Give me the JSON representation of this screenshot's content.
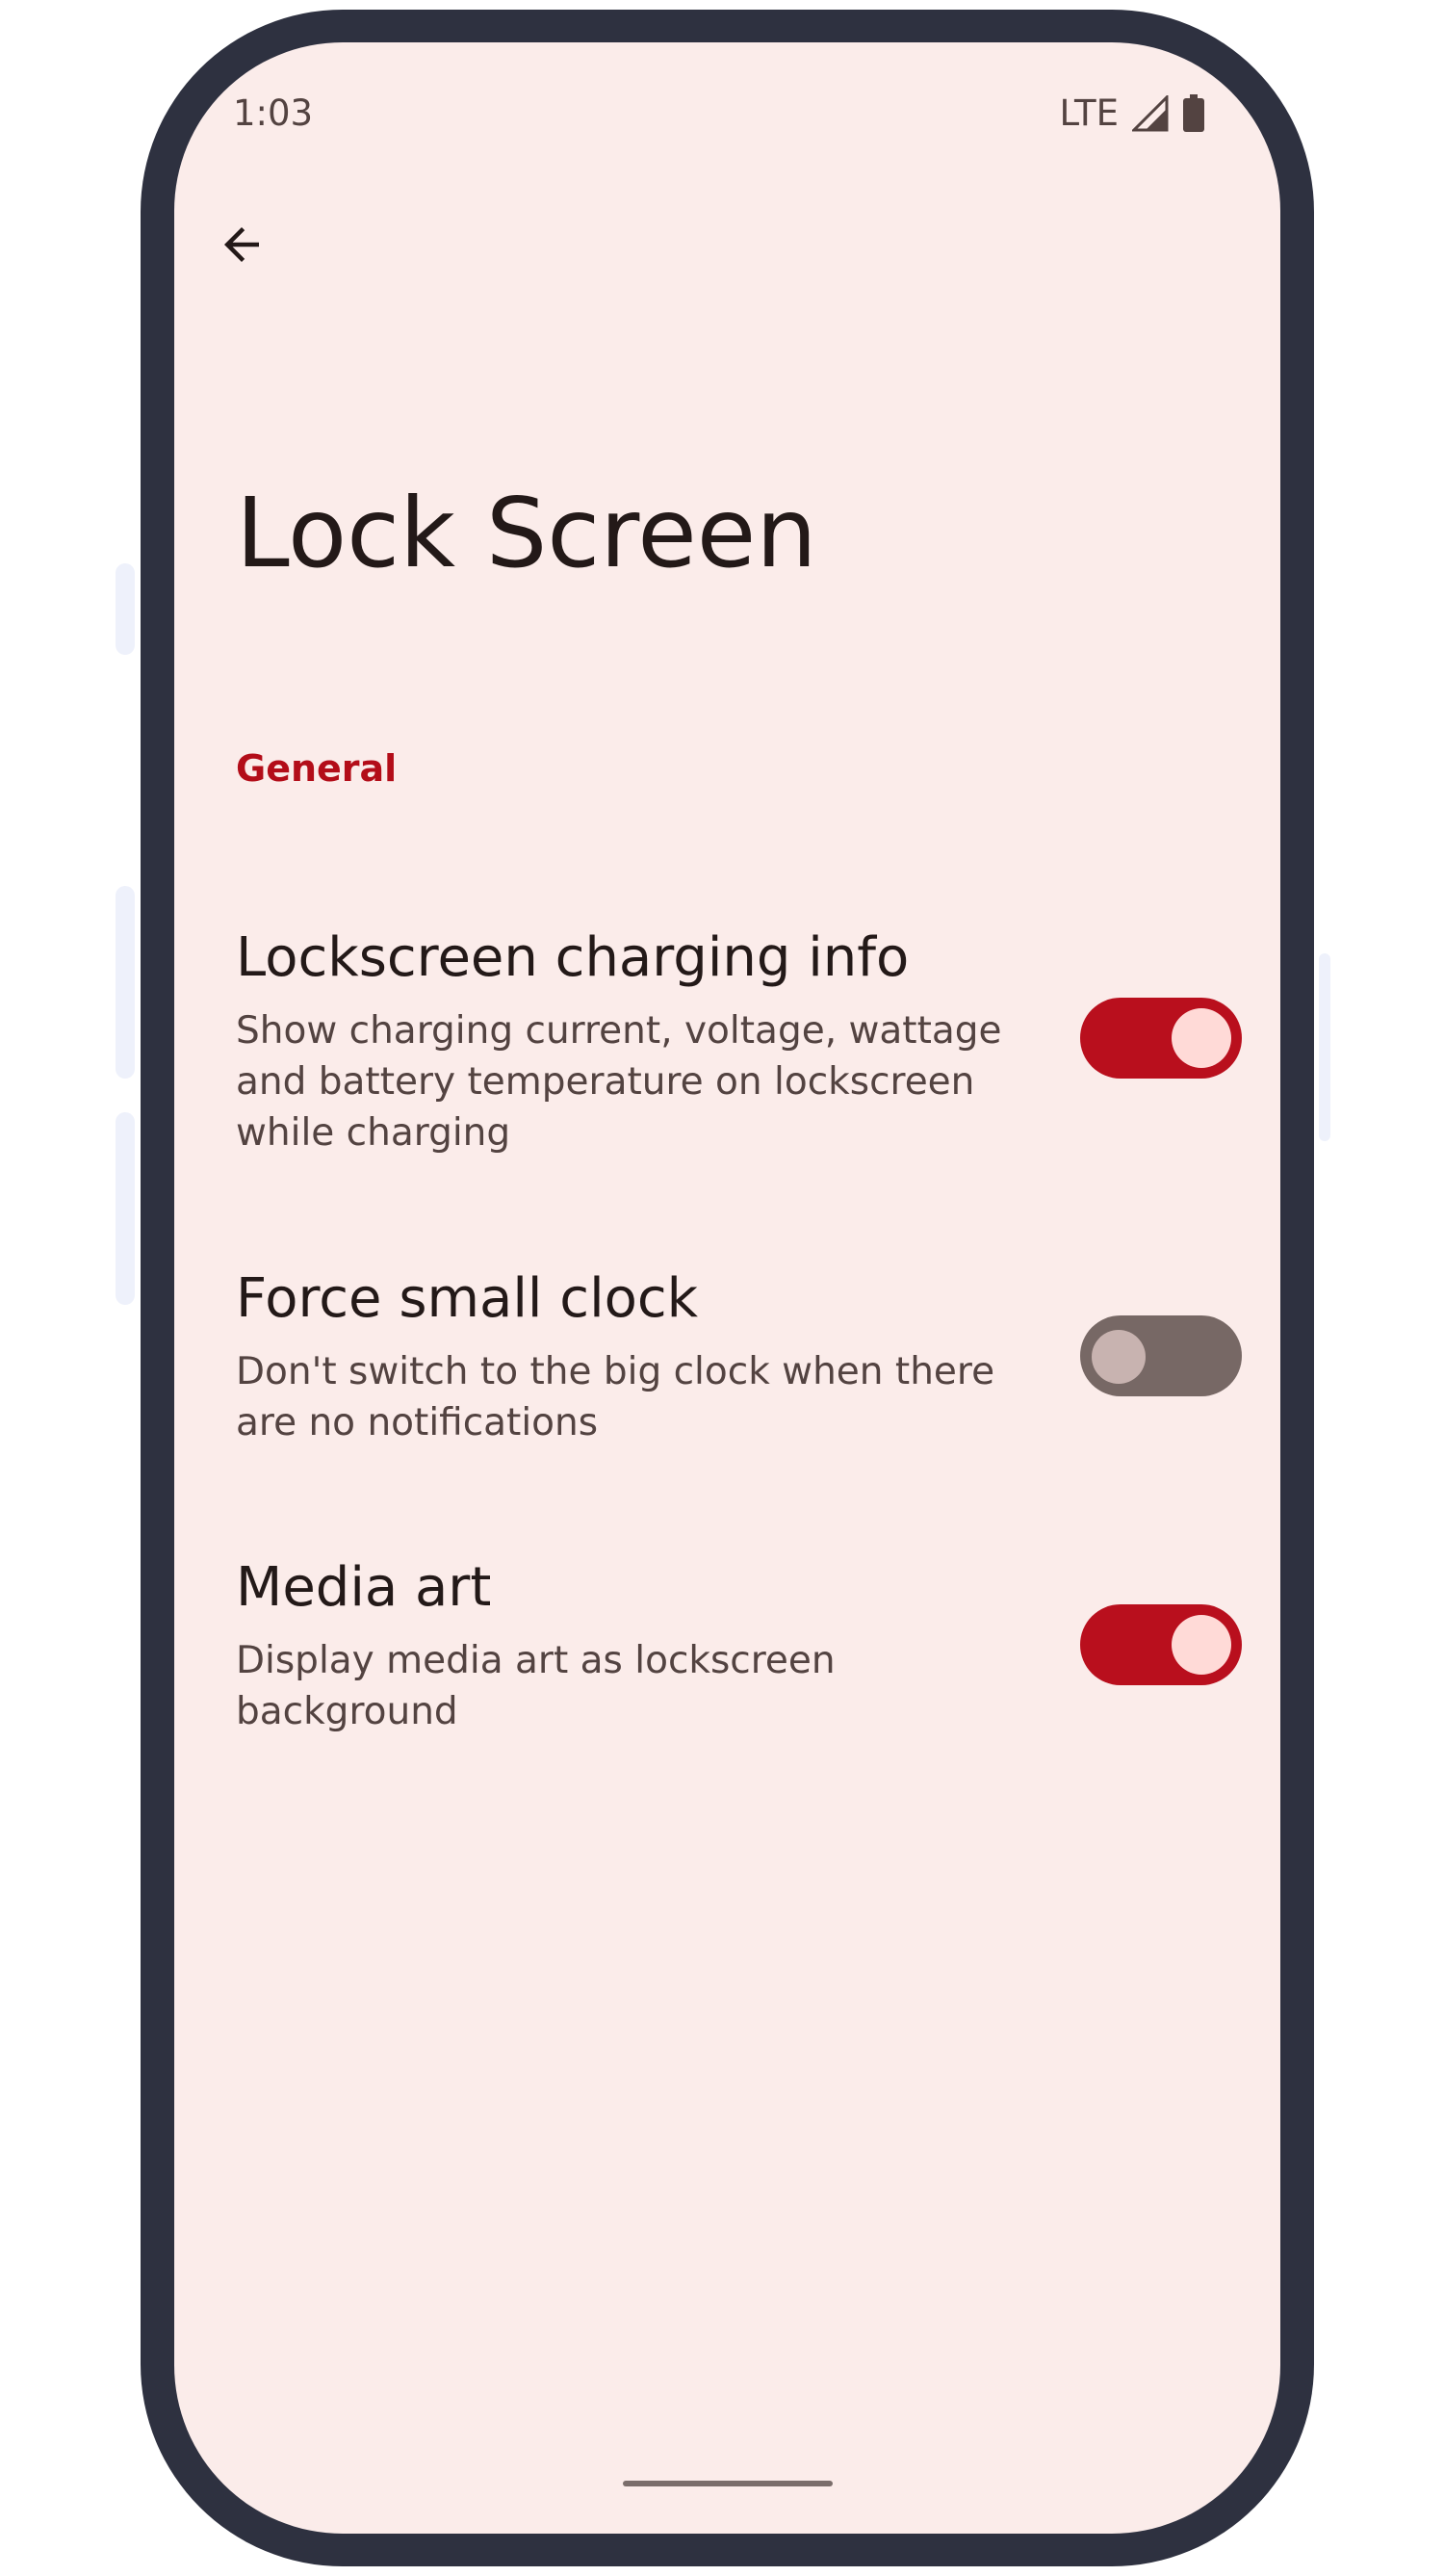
{
  "status_bar": {
    "time": "1:03",
    "network": "LTE",
    "icons": [
      "signal-icon",
      "battery-icon"
    ]
  },
  "app_bar": {
    "back_icon": "arrow-back-icon"
  },
  "page": {
    "title": "Lock Screen"
  },
  "section": {
    "header": "General"
  },
  "settings": [
    {
      "title": "Lockscreen charging info",
      "description": "Show charging current, voltage, wattage and battery temperature on lockscreen while charging",
      "enabled": true
    },
    {
      "title": "Force small clock",
      "description": "Don't switch to the big clock when there are no notifications",
      "enabled": false
    },
    {
      "title": "Media art",
      "description": "Display media art as lockscreen background",
      "enabled": true
    }
  ],
  "colors": {
    "accent": "#b90f1d",
    "section_header": "#b30d19",
    "background": "#fbecea",
    "frame": "#2e3140"
  }
}
